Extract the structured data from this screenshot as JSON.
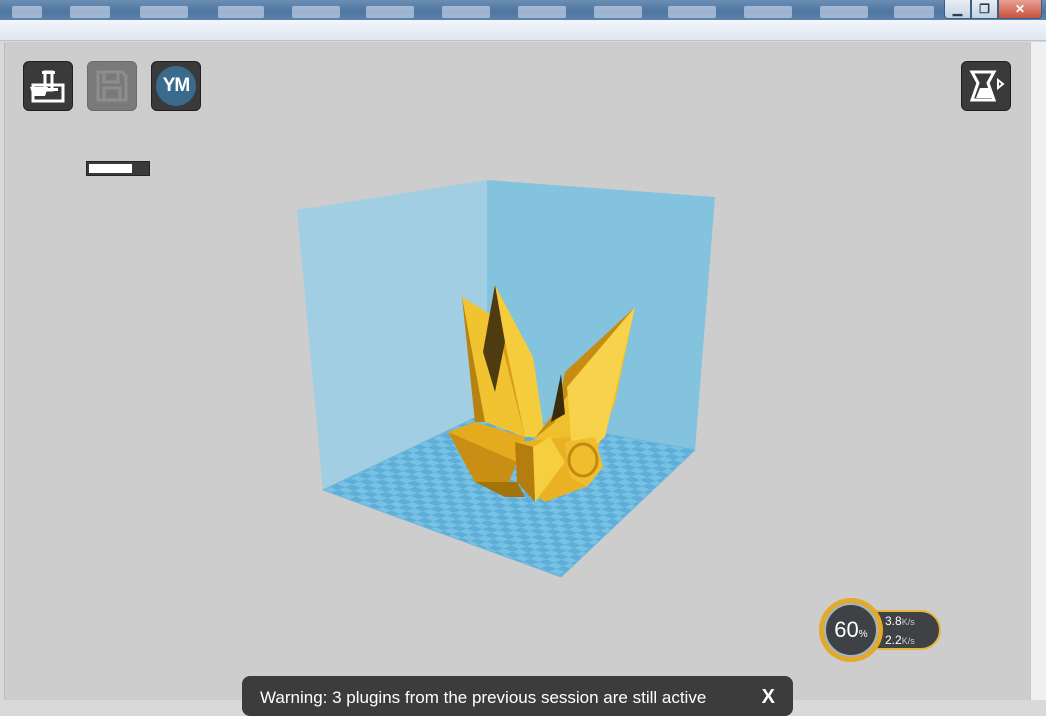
{
  "window": {
    "controls": {
      "minimize": "▁",
      "maximize": "❐",
      "close": "✕"
    }
  },
  "toolbar": {
    "open_icon": "open-file-icon",
    "save_icon": "save-icon",
    "save_enabled": false,
    "ym_label": "YM",
    "progress_fraction": 0.74,
    "view_mode_icon": "view-mode-icon"
  },
  "scene": {
    "build_volume_color": "#7ec4e0",
    "plate_color": "#6ab8df",
    "model_color": "#f0c030"
  },
  "speed_widget": {
    "percent": "60",
    "percent_unit": "%",
    "upload_value": "3.8",
    "upload_unit": "K/s",
    "download_value": "2.2",
    "download_unit": "K/s"
  },
  "toast": {
    "message": "Warning: 3 plugins from the previous session are still active",
    "close_label": "X"
  }
}
